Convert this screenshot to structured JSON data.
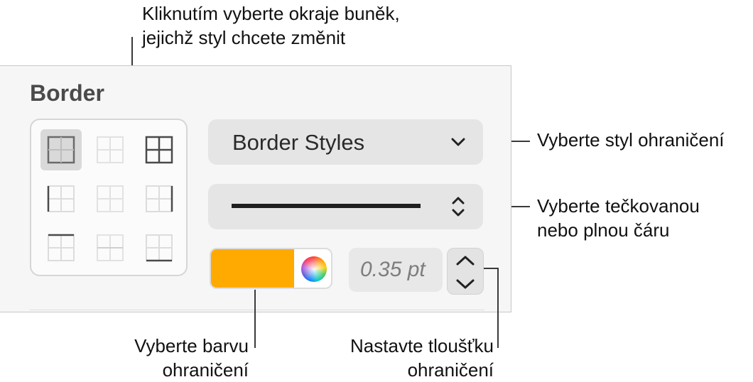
{
  "panel": {
    "title": "Border",
    "border_styles_dropdown": {
      "label": "Border Styles"
    },
    "line_style": {
      "style": "solid"
    },
    "color_well": {
      "color": "#FFAA00"
    },
    "thickness_field": {
      "value": "0.35 pt"
    }
  },
  "callouts": {
    "cell_borders": [
      "Kliknutím vyberte okraje buněk,",
      "jejichž styl chcete změnit"
    ],
    "border_style": "Vyberte styl ohraničení",
    "line_type": [
      "Vyberte tečkovanou",
      "nebo plnou čáru"
    ],
    "color": [
      "Vyberte barvu",
      "ohraničení"
    ],
    "thickness": [
      "Nastavte tloušťku",
      "ohraničení"
    ]
  }
}
